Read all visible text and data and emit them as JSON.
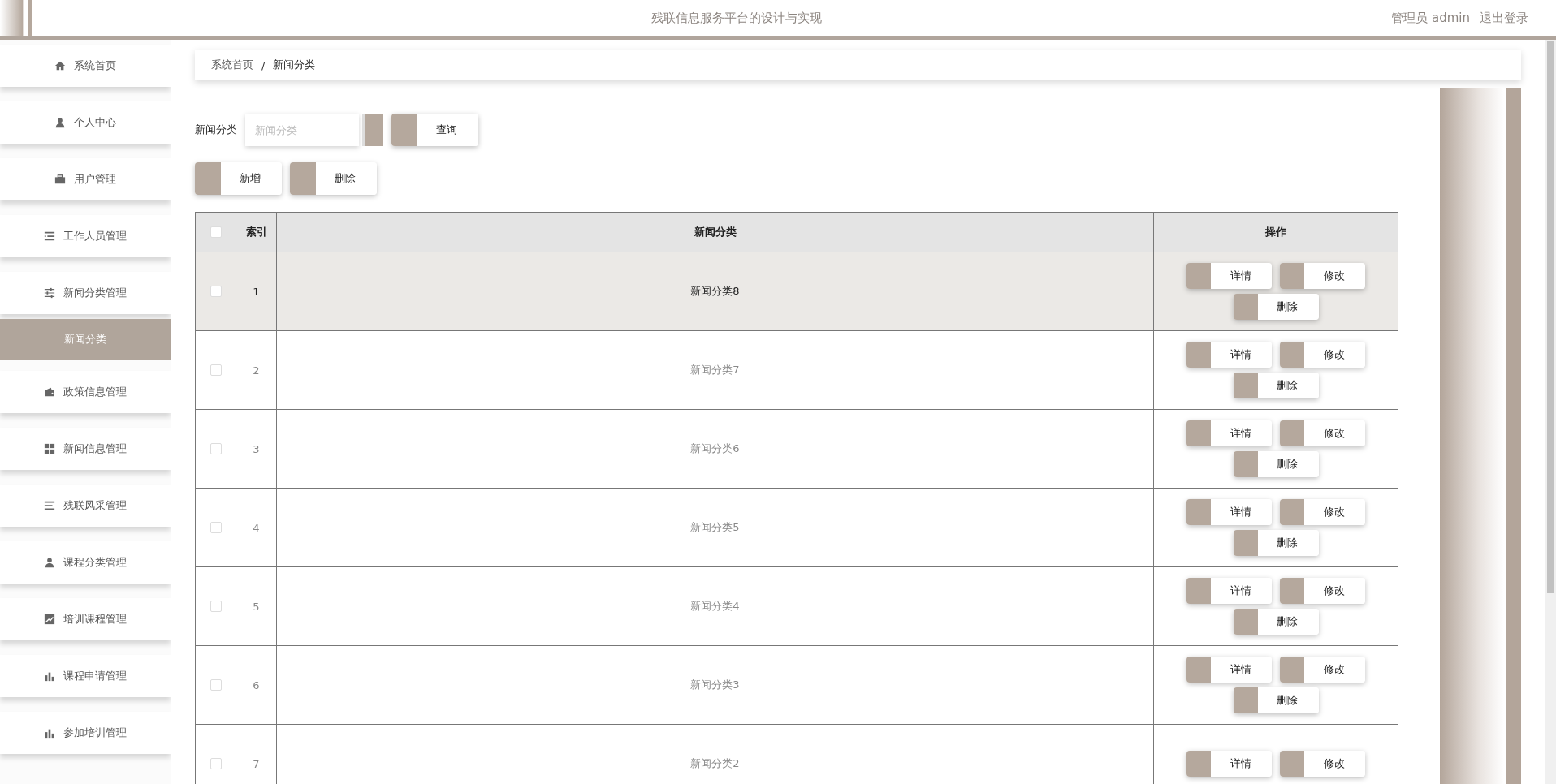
{
  "header": {
    "title": "残联信息服务平台的设计与实现",
    "user": "管理员 admin",
    "logout": "退出登录"
  },
  "sidebar": {
    "items": [
      {
        "label": "系统首页"
      },
      {
        "label": "个人中心"
      },
      {
        "label": "用户管理"
      },
      {
        "label": "工作人员管理"
      },
      {
        "label": "新闻分类管理",
        "children": [
          {
            "label": "新闻分类",
            "selected": true
          }
        ]
      },
      {
        "label": "政策信息管理"
      },
      {
        "label": "新闻信息管理"
      },
      {
        "label": "残联风采管理"
      },
      {
        "label": "课程分类管理"
      },
      {
        "label": "培训课程管理"
      },
      {
        "label": "课程申请管理"
      },
      {
        "label": "参加培训管理"
      }
    ]
  },
  "breadcrumb": [
    "系统首页",
    "新闻分类"
  ],
  "breadcrumb_separator": "/",
  "search": {
    "label": "新闻分类",
    "placeholder": "新闻分类",
    "button": "查询"
  },
  "toolbar": [
    "新增",
    "删除"
  ],
  "table": {
    "header_checkbox": {
      "checked": false
    },
    "columns": [
      "索引",
      "新闻分类",
      "操作"
    ],
    "rows": [
      {
        "index": "1",
        "name": "新闻分类8",
        "checked": false,
        "hovered": true,
        "actions": [
          "详情",
          "修改",
          "删除"
        ]
      },
      {
        "index": "2",
        "name": "新闻分类7",
        "checked": false,
        "hovered": false,
        "actions": [
          "详情",
          "修改",
          "删除"
        ]
      },
      {
        "index": "3",
        "name": "新闻分类6",
        "checked": false,
        "hovered": false,
        "actions": [
          "详情",
          "修改",
          "删除"
        ]
      },
      {
        "index": "4",
        "name": "新闻分类5",
        "checked": false,
        "hovered": false,
        "actions": [
          "详情",
          "修改",
          "删除"
        ]
      },
      {
        "index": "5",
        "name": "新闻分类4",
        "checked": false,
        "hovered": false,
        "actions": [
          "详情",
          "修改",
          "删除"
        ]
      },
      {
        "index": "6",
        "name": "新闻分类3",
        "checked": false,
        "hovered": false,
        "actions": [
          "详情",
          "修改",
          "删除"
        ]
      },
      {
        "index": "7",
        "name": "新闻分类2",
        "checked": false,
        "hovered": false,
        "actions": [
          "详情",
          "修改"
        ]
      }
    ]
  }
}
